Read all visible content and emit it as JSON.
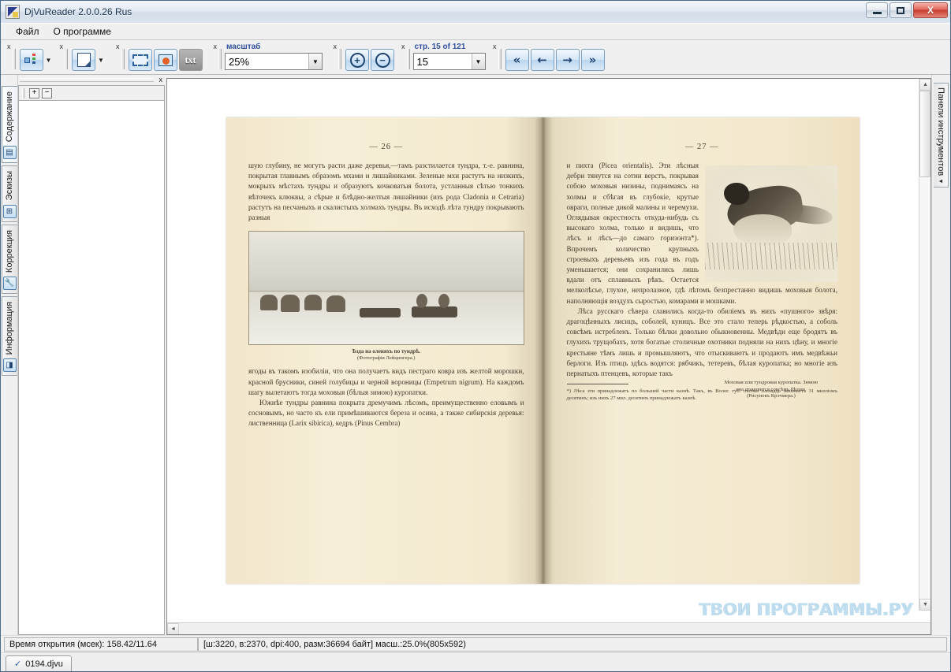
{
  "window": {
    "title": "DjVuReader 2.0.0.26 Rus",
    "app_icon": "djvu-app-icon",
    "minimize_label": "",
    "maximize_label": "",
    "close_label": "X"
  },
  "menu": {
    "items": [
      {
        "label": "Файл"
      },
      {
        "label": "О программе"
      }
    ]
  },
  "toolbar": {
    "close_marks": "x",
    "groups": [
      {
        "name": "navigation-pane",
        "icon": "tree-panel-icon",
        "has_dropdown": true
      },
      {
        "name": "page-layout",
        "icon": "page-layout-icon",
        "has_dropdown": true
      }
    ],
    "tools": [
      {
        "name": "select-region",
        "icon": "selection-marquee-icon"
      },
      {
        "name": "extract-image",
        "icon": "image-extract-icon"
      },
      {
        "name": "extract-text",
        "icon": "txt-icon",
        "label": "txt"
      }
    ],
    "zoom_group": {
      "label": "масштаб",
      "value": "25%",
      "dropdown_caret": "▼"
    },
    "zoom_buttons": [
      {
        "name": "zoom-in",
        "glyph": "+"
      },
      {
        "name": "zoom-out",
        "glyph": "−"
      }
    ],
    "page_group": {
      "label": "стр. 15 of 121",
      "value": "15",
      "dropdown_caret": "▼"
    },
    "nav_buttons": [
      {
        "name": "first-page",
        "glyph": "«"
      },
      {
        "name": "previous-page",
        "glyph": "←"
      },
      {
        "name": "next-page",
        "glyph": "→"
      },
      {
        "name": "last-page",
        "glyph": "»"
      }
    ]
  },
  "sidebar": {
    "close_label": "x",
    "expand_all_label": "+",
    "collapse_all_label": "−",
    "tabs": [
      {
        "label": "Содержание",
        "icon": "contents-icon",
        "active": true
      },
      {
        "label": "Эскизы",
        "icon": "thumbnails-icon",
        "active": false
      },
      {
        "label": "Коррекция",
        "icon": "wrench-icon",
        "active": false
      },
      {
        "label": "Информация",
        "icon": "info-icon",
        "active": false
      }
    ]
  },
  "right_panel": {
    "label": "Панели инструментов",
    "caret": "◄"
  },
  "viewer": {
    "watermark": "ТВОИ ПРОГРАММЫ.РУ",
    "scroll_left_glyph": "◄",
    "scroll_right_glyph": "►",
    "scroll_up_glyph": "▲",
    "scroll_down_glyph": "▼"
  },
  "document": {
    "left_page": {
      "folio": "— 26 —",
      "paragraphs": [
        "шую глубину, не могутъ расти даже деревья,—тамъ разстилается тундра, т.-е. равнина, покрытая главнымъ образомъ мхами и лишайниками. Зеленые мхи растутъ на низкихъ, мокрыхъ мѣстахъ тундры и образуютъ кочковатыя болота, устланныя сѣтью тонкихъ вѣточекъ клюквы, а сѣрые и блѣдно-желтыя лишайники (изъ рода Cladonia и Cetraria) растутъ на песчаныхъ и скалистыхъ холмахъ тундры. Въ исходѣ лѣта тундру покрываютъ разныя"
      ],
      "figure": {
        "name": "reindeer-sled-photo",
        "caption_title": "Ѣзда на оленяхъ по тундрѣ.",
        "caption_credit": "(Фотографія Лейцингера.)"
      },
      "paragraphs_after": [
        "ягоды въ такомъ изобиліи, что она получаетъ видъ пестраго ковра изъ желтой морошки, красной брусники, синей голубицы и черной вороницы (Empetrum nigrum). На каждомъ шагу вылетаютъ тогда моховыя (бѣлыя зимою) куропатки.",
        "Южнѣе тундры равнина покрыта дремучимъ лѣсомъ, преимущественно еловымъ и сосновымъ, но часто къ ели примѣшиваются береза и осина, а также сибирскія деревья: лиственница (Larix sibirica), кедръ (Pinus Cembra)"
      ]
    },
    "right_page": {
      "folio": "— 27 —",
      "paragraphs": [
        "и пихта (Picea orientalis). Эти лѣсныя дебри тянутся на сотни верстъ, покрывая собою моховыя низины, поднимаясь на холмы и сбѣгая въ глубокіе, крутые овраги, полные дикой малины и черемухи. Оглядывая окрестность откуда-нибудь съ высокаго холма, только и видишь, что лѣсъ и лѣсъ—до самаго горизонта*). Впрочемъ количество крупныхъ строевыхъ деревьевъ изъ года въ годъ уменьшается; они сохранились лишь вдали отъ сплавныхъ рѣкъ. Остается мелколѣсье, глухое, непролазное, гдѣ лѣтомъ безпрестанно видишь моховыя болота, наполняющія воздухъ сыростью, комарами и мошками.",
        "Лѣса русскаго сѣвера славились когда-то обиліемъ въ нихъ «пушного» звѣря: драгоцѣнныхъ лисицъ, соболей, куницъ. Все это стало теперь рѣдкостью, а соболь совсѣмъ истребленъ. Только бѣлки довольно обыкновенны. Медвѣди еще бродятъ въ глухихъ трущобахъ, хотя богатые столичные охотники подняли на нихъ цѣну, и многіе крестьяне тѣмъ лишь и промышляютъ, что отыскиваютъ и продаютъ имъ медвѣжьи берлоги. Изъ птицъ здѣсь водятся: рябчикъ, тетеревъ, бѣлая куропатка; но многіе изъ пернатыхъ птенцевъ, которые такъ"
      ],
      "figure": {
        "name": "ptarmigan-illustration",
        "caption_line1": "Моховая или тундровая куропатка. Зимою",
        "caption_line2": "она становится совсѣмъ бѣлою.",
        "caption_credit": "(Рисунокъ Крэчмера.)"
      },
      "footnote": "*) Лѣса эти принадлежатъ по большей части казнѣ. Такъ, въ Волог. губ. лѣсная площадь занимаетъ 31 милліонъ десятинъ; изъ нихъ 27 мил. десятинъ принадлежатъ казнѣ."
    }
  },
  "statusbar": {
    "open_time": "Время открытия (мсек): 158.42/11.64",
    "image_info": "[ш:3220, в:2370, dpi:400, разм:36694 байт] масш.:25.0%(805x592)"
  },
  "taskstrip": {
    "document_tab": "0194.djvu",
    "check_glyph": "✓"
  }
}
